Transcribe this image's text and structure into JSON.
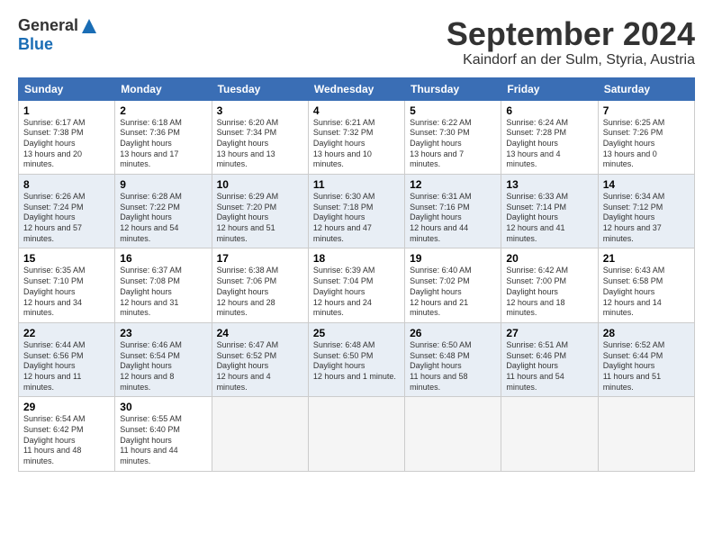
{
  "logo": {
    "general": "General",
    "blue": "Blue"
  },
  "title": "September 2024",
  "location": "Kaindorf an der Sulm, Styria, Austria",
  "days_header": [
    "Sunday",
    "Monday",
    "Tuesday",
    "Wednesday",
    "Thursday",
    "Friday",
    "Saturday"
  ],
  "weeks": [
    [
      {
        "day": "1",
        "sunrise": "6:17 AM",
        "sunset": "7:38 PM",
        "daylight": "13 hours and 20 minutes."
      },
      {
        "day": "2",
        "sunrise": "6:18 AM",
        "sunset": "7:36 PM",
        "daylight": "13 hours and 17 minutes."
      },
      {
        "day": "3",
        "sunrise": "6:20 AM",
        "sunset": "7:34 PM",
        "daylight": "13 hours and 13 minutes."
      },
      {
        "day": "4",
        "sunrise": "6:21 AM",
        "sunset": "7:32 PM",
        "daylight": "13 hours and 10 minutes."
      },
      {
        "day": "5",
        "sunrise": "6:22 AM",
        "sunset": "7:30 PM",
        "daylight": "13 hours and 7 minutes."
      },
      {
        "day": "6",
        "sunrise": "6:24 AM",
        "sunset": "7:28 PM",
        "daylight": "13 hours and 4 minutes."
      },
      {
        "day": "7",
        "sunrise": "6:25 AM",
        "sunset": "7:26 PM",
        "daylight": "13 hours and 0 minutes."
      }
    ],
    [
      {
        "day": "8",
        "sunrise": "6:26 AM",
        "sunset": "7:24 PM",
        "daylight": "12 hours and 57 minutes."
      },
      {
        "day": "9",
        "sunrise": "6:28 AM",
        "sunset": "7:22 PM",
        "daylight": "12 hours and 54 minutes."
      },
      {
        "day": "10",
        "sunrise": "6:29 AM",
        "sunset": "7:20 PM",
        "daylight": "12 hours and 51 minutes."
      },
      {
        "day": "11",
        "sunrise": "6:30 AM",
        "sunset": "7:18 PM",
        "daylight": "12 hours and 47 minutes."
      },
      {
        "day": "12",
        "sunrise": "6:31 AM",
        "sunset": "7:16 PM",
        "daylight": "12 hours and 44 minutes."
      },
      {
        "day": "13",
        "sunrise": "6:33 AM",
        "sunset": "7:14 PM",
        "daylight": "12 hours and 41 minutes."
      },
      {
        "day": "14",
        "sunrise": "6:34 AM",
        "sunset": "7:12 PM",
        "daylight": "12 hours and 37 minutes."
      }
    ],
    [
      {
        "day": "15",
        "sunrise": "6:35 AM",
        "sunset": "7:10 PM",
        "daylight": "12 hours and 34 minutes."
      },
      {
        "day": "16",
        "sunrise": "6:37 AM",
        "sunset": "7:08 PM",
        "daylight": "12 hours and 31 minutes."
      },
      {
        "day": "17",
        "sunrise": "6:38 AM",
        "sunset": "7:06 PM",
        "daylight": "12 hours and 28 minutes."
      },
      {
        "day": "18",
        "sunrise": "6:39 AM",
        "sunset": "7:04 PM",
        "daylight": "12 hours and 24 minutes."
      },
      {
        "day": "19",
        "sunrise": "6:40 AM",
        "sunset": "7:02 PM",
        "daylight": "12 hours and 21 minutes."
      },
      {
        "day": "20",
        "sunrise": "6:42 AM",
        "sunset": "7:00 PM",
        "daylight": "12 hours and 18 minutes."
      },
      {
        "day": "21",
        "sunrise": "6:43 AM",
        "sunset": "6:58 PM",
        "daylight": "12 hours and 14 minutes."
      }
    ],
    [
      {
        "day": "22",
        "sunrise": "6:44 AM",
        "sunset": "6:56 PM",
        "daylight": "12 hours and 11 minutes."
      },
      {
        "day": "23",
        "sunrise": "6:46 AM",
        "sunset": "6:54 PM",
        "daylight": "12 hours and 8 minutes."
      },
      {
        "day": "24",
        "sunrise": "6:47 AM",
        "sunset": "6:52 PM",
        "daylight": "12 hours and 4 minutes."
      },
      {
        "day": "25",
        "sunrise": "6:48 AM",
        "sunset": "6:50 PM",
        "daylight": "12 hours and 1 minute."
      },
      {
        "day": "26",
        "sunrise": "6:50 AM",
        "sunset": "6:48 PM",
        "daylight": "11 hours and 58 minutes."
      },
      {
        "day": "27",
        "sunrise": "6:51 AM",
        "sunset": "6:46 PM",
        "daylight": "11 hours and 54 minutes."
      },
      {
        "day": "28",
        "sunrise": "6:52 AM",
        "sunset": "6:44 PM",
        "daylight": "11 hours and 51 minutes."
      }
    ],
    [
      {
        "day": "29",
        "sunrise": "6:54 AM",
        "sunset": "6:42 PM",
        "daylight": "11 hours and 48 minutes."
      },
      {
        "day": "30",
        "sunrise": "6:55 AM",
        "sunset": "6:40 PM",
        "daylight": "11 hours and 44 minutes."
      },
      null,
      null,
      null,
      null,
      null
    ]
  ]
}
